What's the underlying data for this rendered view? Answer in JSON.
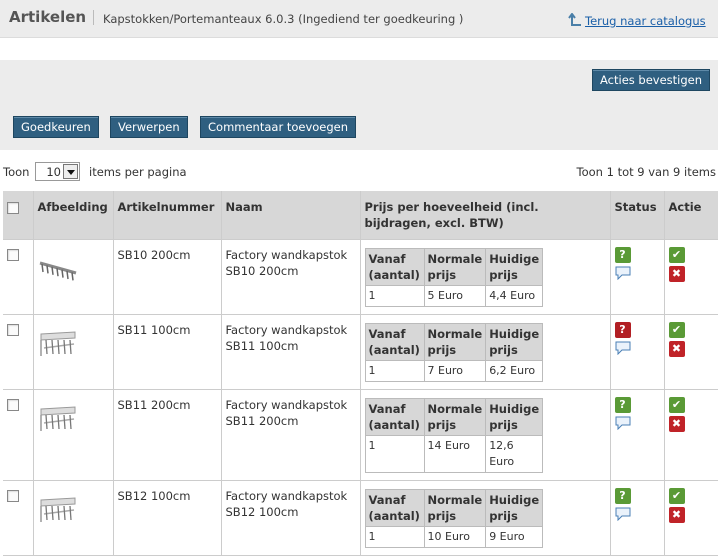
{
  "header": {
    "title": "Artikelen",
    "breadcrumb": "Kapstokken/Portemanteaux 6.0.3  (Ingediend ter goedkeuring )",
    "back_link": "Terug naar catalogus"
  },
  "actions": {
    "confirm": "Acties bevestigen",
    "approve": "Goedkeuren",
    "reject": "Verwerpen",
    "add_comment": "Commentaar toevoegen"
  },
  "pager": {
    "show_label": "Toon",
    "per_page_value": "10",
    "per_page_label": "items per pagina",
    "info": "Toon 1 tot 9 van 9 items"
  },
  "table": {
    "headers": {
      "image": "Afbeelding",
      "article_number": "Artikelnummer",
      "name": "Naam",
      "price": "Prijs per hoeveelheid (incl. bijdragen, excl. BTW)",
      "status": "Status",
      "action": "Actie"
    },
    "price_headers": {
      "from": "Vanaf (aantal)",
      "normal": "Normale prijs",
      "current": "Huidige prijs"
    },
    "rows": [
      {
        "number": "SB10 200cm",
        "name": "Factory wandkapstok SB10 200cm",
        "from": "1",
        "normal": "5 Euro",
        "current": "4,4 Euro",
        "status_color": "#5a9a36"
      },
      {
        "number": "SB11 100cm",
        "name": "Factory wandkapstok SB11 100cm",
        "from": "1",
        "normal": "7 Euro",
        "current": "6,2 Euro",
        "status_color": "#b21f24"
      },
      {
        "number": "SB11 200cm",
        "name": "Factory wandkapstok SB11 200cm",
        "from": "1",
        "normal": "14 Euro",
        "current": "12,6 Euro",
        "status_color": "#5a9a36"
      },
      {
        "number": "SB12 100cm",
        "name": "Factory wandkapstok SB12 100cm",
        "from": "1",
        "normal": "10 Euro",
        "current": "9 Euro",
        "status_color": "#5a9a36"
      }
    ]
  },
  "icons": {
    "status": "question-icon",
    "comment": "speech-bubble-icon",
    "approve": "checkmark-icon",
    "reject": "cross-icon",
    "back": "back-arrow-icon"
  }
}
